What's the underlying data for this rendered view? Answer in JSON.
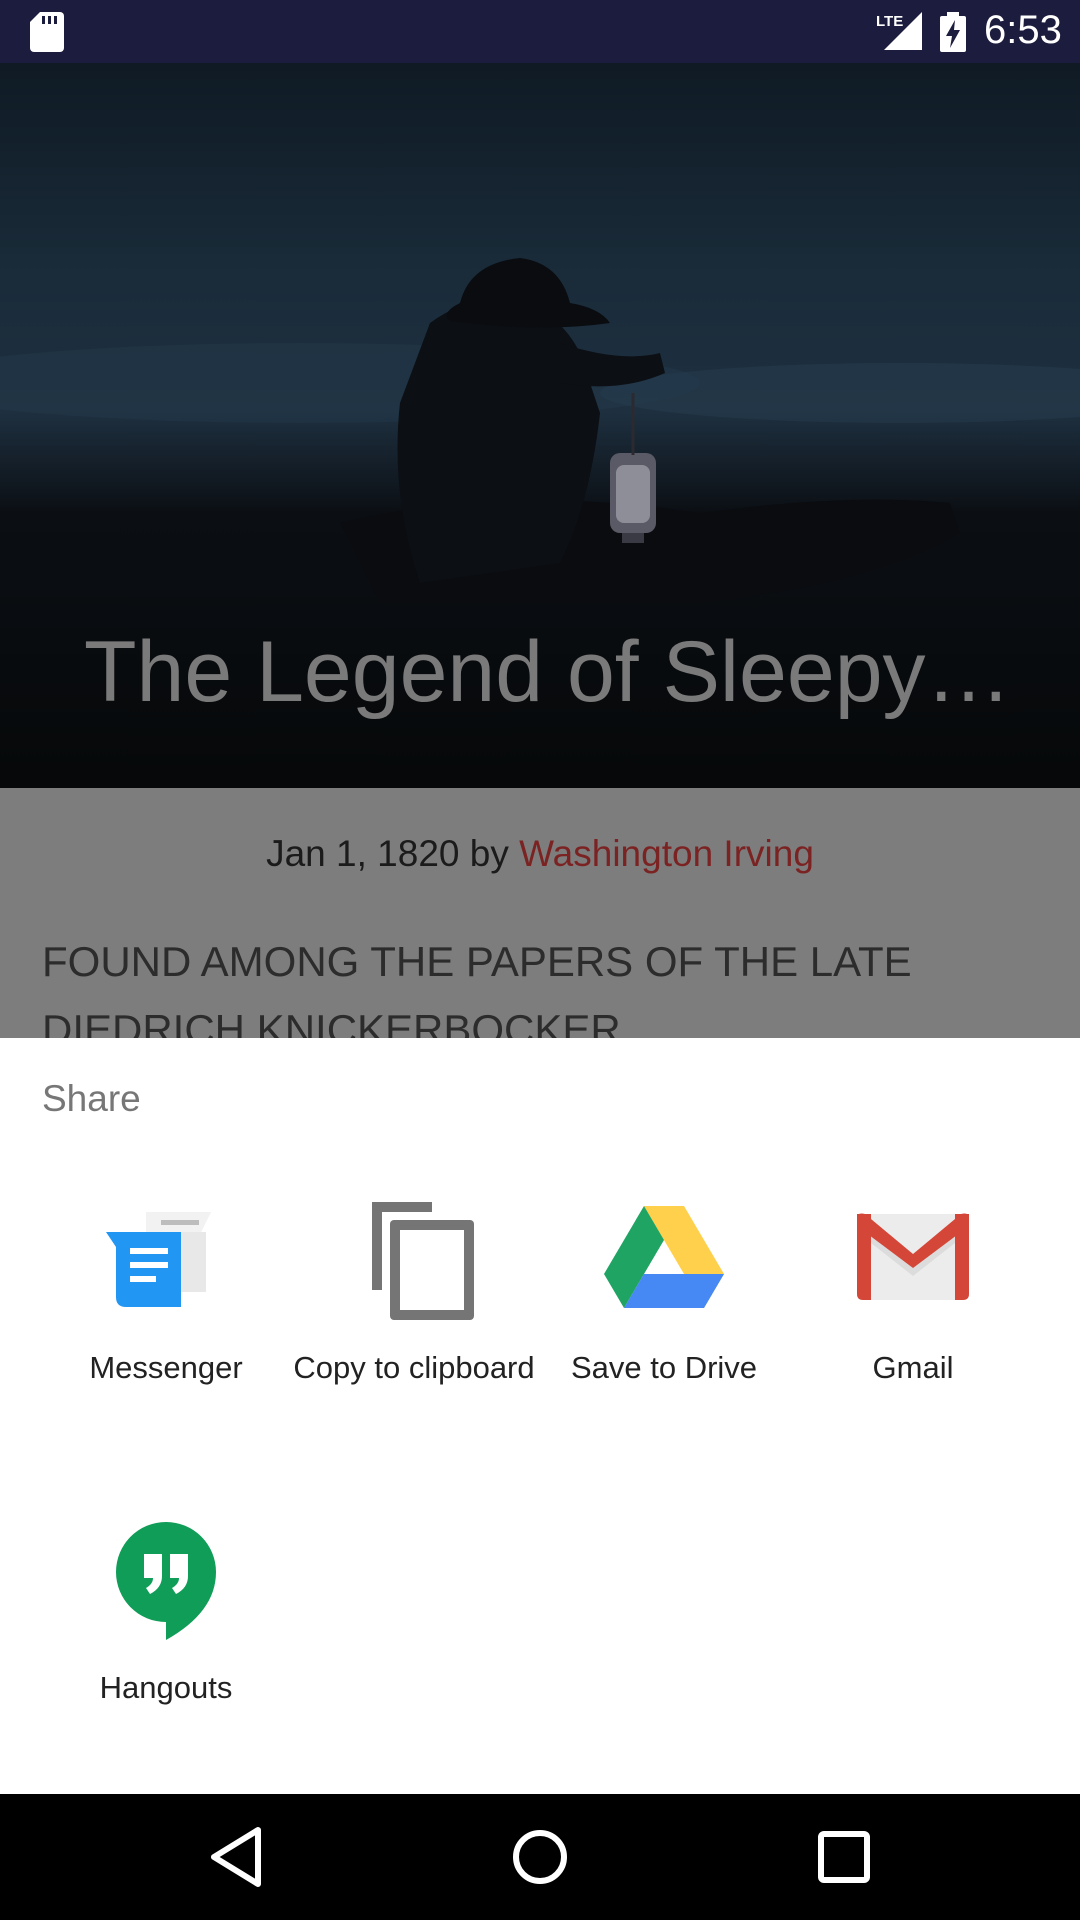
{
  "status_bar": {
    "time": "6:53",
    "network": "LTE",
    "icons": [
      "sd-card-icon",
      "lte-signal-icon",
      "battery-charging-icon"
    ]
  },
  "article": {
    "title": "The Legend of Sleepy…",
    "date_by": "Jan 1, 1820 by ",
    "author": "Washington Irving",
    "body": "FOUND AMONG THE PAPERS OF THE LATE DIEDRICH KNICKERBOCKER."
  },
  "share_sheet": {
    "title": "Share",
    "targets": [
      {
        "label": "Messenger",
        "icon": "messenger-icon"
      },
      {
        "label": "Copy to clipboard",
        "icon": "copy-icon"
      },
      {
        "label": "Save to Drive",
        "icon": "google-drive-icon"
      },
      {
        "label": "Gmail",
        "icon": "gmail-icon"
      },
      {
        "label": "Hangouts",
        "icon": "hangouts-icon"
      }
    ]
  },
  "nav_bar": {
    "buttons": [
      "back-icon",
      "home-icon",
      "recents-icon"
    ]
  },
  "colors": {
    "status_bar": "#1c1c3e",
    "author_link": "#7b2322",
    "sheet_background": "#ffffff",
    "drive_green": "#1fa463",
    "drive_yellow": "#ffd04b",
    "drive_blue": "#4688f4",
    "gmail_red": "#d44638",
    "hangouts_green": "#0f9d58",
    "messenger_blue": "#2196f3"
  }
}
